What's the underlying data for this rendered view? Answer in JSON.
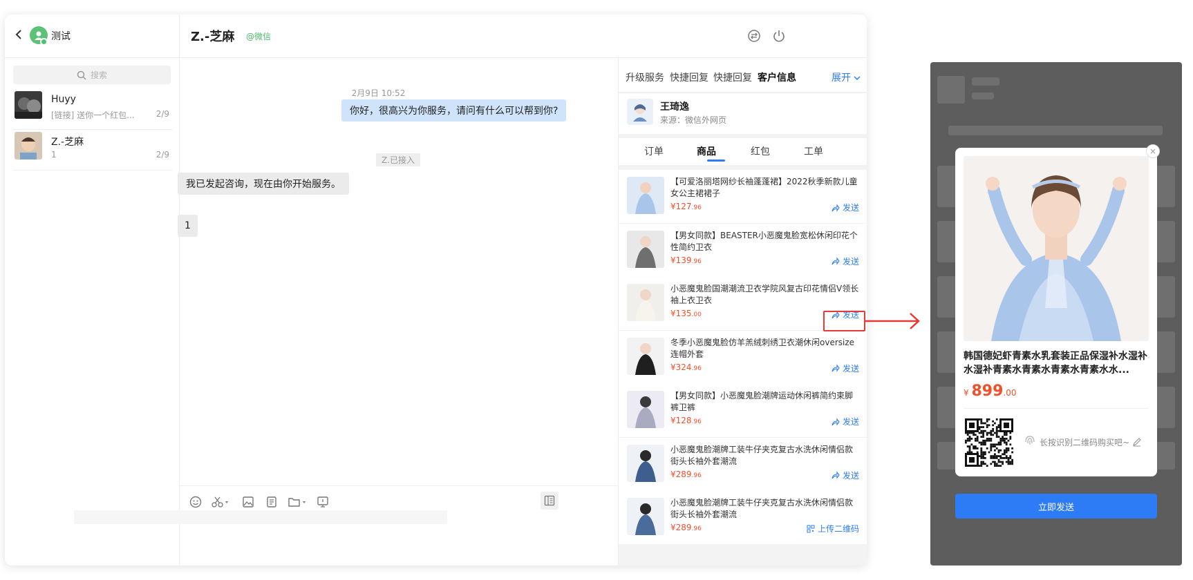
{
  "sidebar": {
    "title": "测试",
    "search_placeholder": "搜索",
    "conversations": [
      {
        "name": "Huyy",
        "preview": "[链接] 送你一个红包...",
        "count": "2/9"
      },
      {
        "name": "Z.-芝麻",
        "preview": "1",
        "count": "2/9"
      }
    ]
  },
  "chat": {
    "contact_name": "Z.-芝麻",
    "contact_tag": "@微信",
    "time": "2月9日 10:52",
    "messages": [
      {
        "side": "right",
        "text": "你好，很高兴为你服务，请问有什么可以帮到你?"
      },
      {
        "side": "left",
        "text": "我已发起咨询，现在由你开始服务。"
      },
      {
        "side": "left",
        "text": "1"
      }
    ],
    "system_notice": "Z.已接入"
  },
  "panel": {
    "tabs": [
      "升级服务",
      "快捷回复",
      "快捷回复",
      "客户信息"
    ],
    "expand": "展开",
    "customer": {
      "name": "王琦逸",
      "source": "来源：微信外网页"
    },
    "subtabs": [
      "订单",
      "商品",
      "红包",
      "工单"
    ],
    "products": [
      {
        "title": "【可爱洛丽塔网纱长袖蓬蓬裙】2022秋季新款儿童女公主裙裙子",
        "price": "127",
        "cents": ".96",
        "action": "发送"
      },
      {
        "title": "【男女同款】BEASTER小恶魔鬼脸宽松休闲印花个性简约卫衣",
        "price": "139",
        "cents": ".96",
        "action": "发送"
      },
      {
        "title": "小恶魔鬼脸国潮潮流卫衣学院风复古印花情侣V领长袖上衣卫衣",
        "price": "135",
        "cents": ".00",
        "action": "发送"
      },
      {
        "title": "冬季小恶魔鬼脸仿羊羔绒刺绣卫衣潮休闲oversize连帽外套",
        "price": "324",
        "cents": ".96",
        "action": "发送"
      },
      {
        "title": "【男女同款】小恶魔鬼脸潮牌运动休闲裤简约束脚裤卫裤",
        "price": "128",
        "cents": ".96",
        "action": "发送"
      },
      {
        "title": "小恶魔鬼脸潮牌工装牛仔夹克复古水洗休闲情侣款街头长袖外套潮流",
        "price": "289",
        "cents": ".96",
        "action": "发送"
      },
      {
        "title": "小恶魔鬼脸潮牌工装牛仔夹克复古水洗休闲情侣款街头长袖外套潮流",
        "price": "289",
        "cents": ".96",
        "action": "上传二维码"
      }
    ],
    "currency": "¥"
  },
  "preview": {
    "title": "韩国德妃虾青素水乳套装正品保湿补水湿补水湿补青素水青素水青素水青素水水...",
    "currency": "¥",
    "price": "899",
    "cents": ".00",
    "hint": "长按识别二维码购买吧~",
    "send_button": "立即发送",
    "close": "×"
  },
  "colors": {
    "accent": "#2d7cf6",
    "price": "#f0502c",
    "highlight": "#e53935",
    "bubble_right": "#cfe3fb"
  }
}
